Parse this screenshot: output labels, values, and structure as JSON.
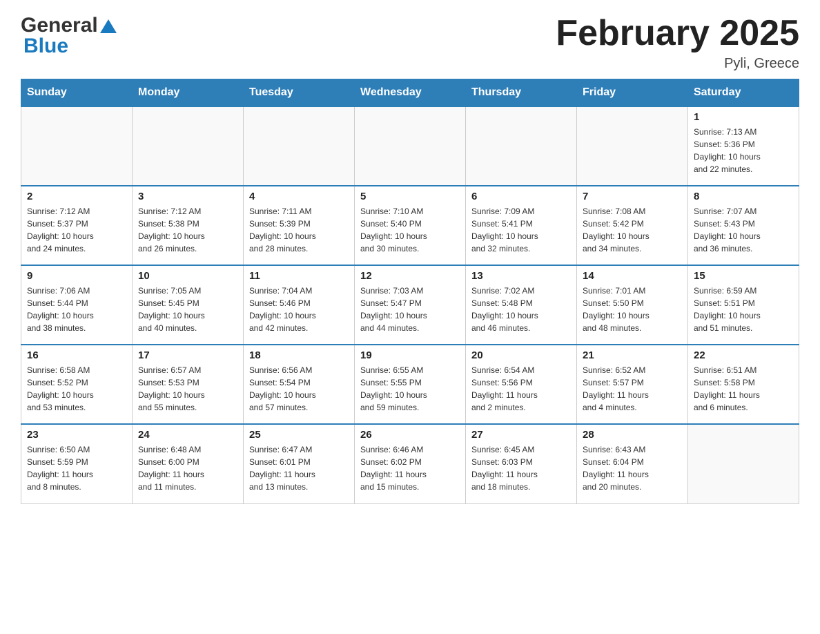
{
  "header": {
    "month_title": "February 2025",
    "location": "Pyli, Greece"
  },
  "days_of_week": [
    "Sunday",
    "Monday",
    "Tuesday",
    "Wednesday",
    "Thursday",
    "Friday",
    "Saturday"
  ],
  "weeks": [
    [
      {
        "day": "",
        "info": ""
      },
      {
        "day": "",
        "info": ""
      },
      {
        "day": "",
        "info": ""
      },
      {
        "day": "",
        "info": ""
      },
      {
        "day": "",
        "info": ""
      },
      {
        "day": "",
        "info": ""
      },
      {
        "day": "1",
        "info": "Sunrise: 7:13 AM\nSunset: 5:36 PM\nDaylight: 10 hours\nand 22 minutes."
      }
    ],
    [
      {
        "day": "2",
        "info": "Sunrise: 7:12 AM\nSunset: 5:37 PM\nDaylight: 10 hours\nand 24 minutes."
      },
      {
        "day": "3",
        "info": "Sunrise: 7:12 AM\nSunset: 5:38 PM\nDaylight: 10 hours\nand 26 minutes."
      },
      {
        "day": "4",
        "info": "Sunrise: 7:11 AM\nSunset: 5:39 PM\nDaylight: 10 hours\nand 28 minutes."
      },
      {
        "day": "5",
        "info": "Sunrise: 7:10 AM\nSunset: 5:40 PM\nDaylight: 10 hours\nand 30 minutes."
      },
      {
        "day": "6",
        "info": "Sunrise: 7:09 AM\nSunset: 5:41 PM\nDaylight: 10 hours\nand 32 minutes."
      },
      {
        "day": "7",
        "info": "Sunrise: 7:08 AM\nSunset: 5:42 PM\nDaylight: 10 hours\nand 34 minutes."
      },
      {
        "day": "8",
        "info": "Sunrise: 7:07 AM\nSunset: 5:43 PM\nDaylight: 10 hours\nand 36 minutes."
      }
    ],
    [
      {
        "day": "9",
        "info": "Sunrise: 7:06 AM\nSunset: 5:44 PM\nDaylight: 10 hours\nand 38 minutes."
      },
      {
        "day": "10",
        "info": "Sunrise: 7:05 AM\nSunset: 5:45 PM\nDaylight: 10 hours\nand 40 minutes."
      },
      {
        "day": "11",
        "info": "Sunrise: 7:04 AM\nSunset: 5:46 PM\nDaylight: 10 hours\nand 42 minutes."
      },
      {
        "day": "12",
        "info": "Sunrise: 7:03 AM\nSunset: 5:47 PM\nDaylight: 10 hours\nand 44 minutes."
      },
      {
        "day": "13",
        "info": "Sunrise: 7:02 AM\nSunset: 5:48 PM\nDaylight: 10 hours\nand 46 minutes."
      },
      {
        "day": "14",
        "info": "Sunrise: 7:01 AM\nSunset: 5:50 PM\nDaylight: 10 hours\nand 48 minutes."
      },
      {
        "day": "15",
        "info": "Sunrise: 6:59 AM\nSunset: 5:51 PM\nDaylight: 10 hours\nand 51 minutes."
      }
    ],
    [
      {
        "day": "16",
        "info": "Sunrise: 6:58 AM\nSunset: 5:52 PM\nDaylight: 10 hours\nand 53 minutes."
      },
      {
        "day": "17",
        "info": "Sunrise: 6:57 AM\nSunset: 5:53 PM\nDaylight: 10 hours\nand 55 minutes."
      },
      {
        "day": "18",
        "info": "Sunrise: 6:56 AM\nSunset: 5:54 PM\nDaylight: 10 hours\nand 57 minutes."
      },
      {
        "day": "19",
        "info": "Sunrise: 6:55 AM\nSunset: 5:55 PM\nDaylight: 10 hours\nand 59 minutes."
      },
      {
        "day": "20",
        "info": "Sunrise: 6:54 AM\nSunset: 5:56 PM\nDaylight: 11 hours\nand 2 minutes."
      },
      {
        "day": "21",
        "info": "Sunrise: 6:52 AM\nSunset: 5:57 PM\nDaylight: 11 hours\nand 4 minutes."
      },
      {
        "day": "22",
        "info": "Sunrise: 6:51 AM\nSunset: 5:58 PM\nDaylight: 11 hours\nand 6 minutes."
      }
    ],
    [
      {
        "day": "23",
        "info": "Sunrise: 6:50 AM\nSunset: 5:59 PM\nDaylight: 11 hours\nand 8 minutes."
      },
      {
        "day": "24",
        "info": "Sunrise: 6:48 AM\nSunset: 6:00 PM\nDaylight: 11 hours\nand 11 minutes."
      },
      {
        "day": "25",
        "info": "Sunrise: 6:47 AM\nSunset: 6:01 PM\nDaylight: 11 hours\nand 13 minutes."
      },
      {
        "day": "26",
        "info": "Sunrise: 6:46 AM\nSunset: 6:02 PM\nDaylight: 11 hours\nand 15 minutes."
      },
      {
        "day": "27",
        "info": "Sunrise: 6:45 AM\nSunset: 6:03 PM\nDaylight: 11 hours\nand 18 minutes."
      },
      {
        "day": "28",
        "info": "Sunrise: 6:43 AM\nSunset: 6:04 PM\nDaylight: 11 hours\nand 20 minutes."
      },
      {
        "day": "",
        "info": ""
      }
    ]
  ]
}
